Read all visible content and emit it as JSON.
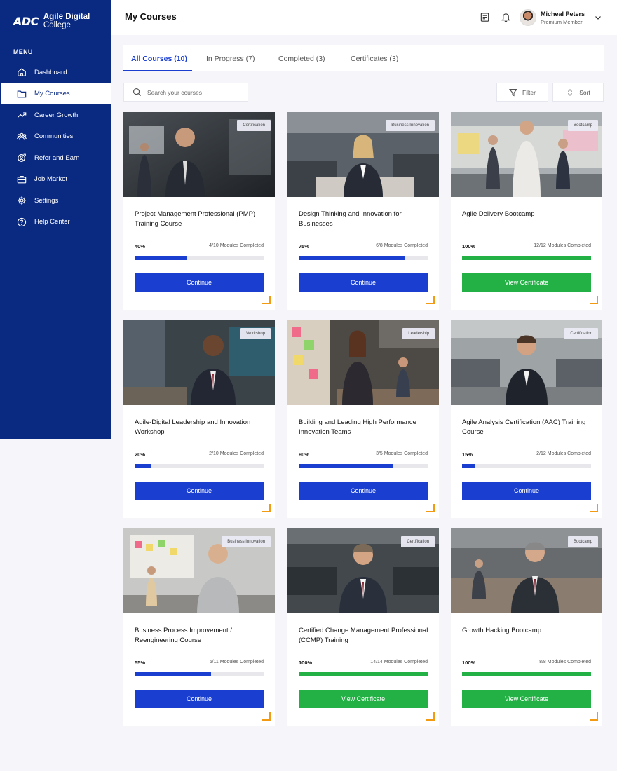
{
  "brand": {
    "mark": "ADC",
    "line1": "Agile Digital",
    "line2": "College"
  },
  "sidebar": {
    "menu_label": "MENU",
    "items": [
      {
        "label": "Dashboard",
        "icon": "home-icon"
      },
      {
        "label": "My Courses",
        "icon": "folder-icon",
        "active": true
      },
      {
        "label": "Career Growth",
        "icon": "trend-icon"
      },
      {
        "label": "Communities",
        "icon": "users-icon"
      },
      {
        "label": "Refer and Earn",
        "icon": "refer-icon"
      },
      {
        "label": "Job Market",
        "icon": "briefcase-icon"
      },
      {
        "label": "Settings",
        "icon": "gear-icon"
      },
      {
        "label": "Help Center",
        "icon": "help-icon"
      }
    ]
  },
  "header": {
    "title": "My Courses"
  },
  "user": {
    "name": "Micheal Peters",
    "role": "Premium Member"
  },
  "tabs": [
    {
      "label": "All Courses (10)",
      "active": true
    },
    {
      "label": "In Progress (7)"
    },
    {
      "label": "Completed (3)"
    },
    {
      "label": "Certificates (3)"
    }
  ],
  "search": {
    "placeholder": "Search your courses"
  },
  "toolbar": {
    "filter_label": "Filter",
    "sort_label": "Sort"
  },
  "colors": {
    "primary": "#1a3fd0",
    "success": "#23b045",
    "sidebar": "#0a2a82",
    "accent": "#f29a12"
  },
  "courses": [
    {
      "badge": "Certification",
      "title": "Project Management Professional (PMP) Training Course",
      "percent_label": "40%",
      "progress": 0.4,
      "modules": "4/10 Modules Completed",
      "button": "Continue",
      "state": "continue"
    },
    {
      "badge": "Business Innovation",
      "title": "Design Thinking and Innovation for Businesses",
      "percent_label": "75%",
      "progress": 0.82,
      "modules": "6/8 Modules Completed",
      "button": "Continue",
      "state": "continue"
    },
    {
      "badge": "Bootcamp",
      "title": "Agile Delivery Bootcamp",
      "percent_label": "100%",
      "progress": 1.0,
      "modules": "12/12 Modules Completed",
      "button": "View Certificate",
      "state": "complete"
    },
    {
      "badge": "Workshop",
      "title": "Agile-Digital Leadership and Innovation Workshop",
      "percent_label": "20%",
      "progress": 0.13,
      "modules": "2/10 Modules Completed",
      "button": "Continue",
      "state": "continue"
    },
    {
      "badge": "Leadership",
      "title": "Building and Leading High Performance Innovation Teams",
      "percent_label": "60%",
      "progress": 0.73,
      "modules": "3/5 Modules Completed",
      "button": "Continue",
      "state": "continue"
    },
    {
      "badge": "Certification",
      "title": "Agile Analysis Certification (AAC) Training Course",
      "percent_label": "15%",
      "progress": 0.1,
      "modules": "2/12 Modules Completed",
      "button": "Continue",
      "state": "continue"
    },
    {
      "badge": "Business Innovation",
      "title": "Business Process Improvement / Reengineering Course",
      "percent_label": "55%",
      "progress": 0.59,
      "modules": "6/11 Modules Completed",
      "button": "Continue",
      "state": "continue"
    },
    {
      "badge": "Certification",
      "title": "Certified Change Management Professional (CCMP) Training",
      "percent_label": "100%",
      "progress": 1.0,
      "modules": "14/14 Modules Completed",
      "button": "View Certificate",
      "state": "complete"
    },
    {
      "badge": "Bootcamp",
      "title": "Growth Hacking Bootcamp",
      "percent_label": "100%",
      "progress": 1.0,
      "modules": "8/8 Modules Completed",
      "button": "View Certificate",
      "state": "complete"
    }
  ]
}
